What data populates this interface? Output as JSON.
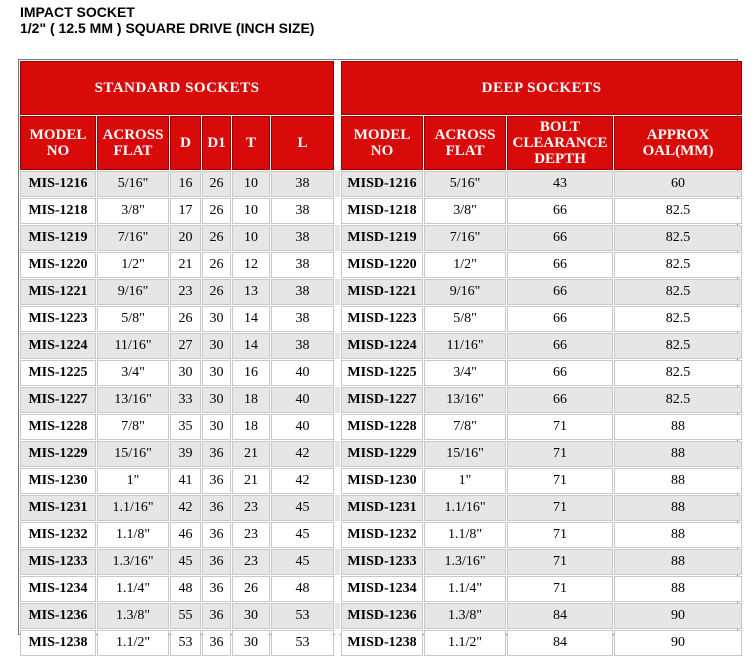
{
  "heading": {
    "line1": "IMPACT SOCKET",
    "line2": "1/2\" ( 12.5 MM ) SQUARE DRIVE (INCH SIZE)"
  },
  "colors": {
    "header_red": "#d90a0a",
    "row_alt_gray": "#e6e6e6"
  },
  "groups": {
    "standard": "STANDARD SOCKETS",
    "deep": "DEEP SOCKETS"
  },
  "columns": {
    "standard": {
      "model": "MODEL NO",
      "across": "ACROSS FLAT",
      "d": "D",
      "d1": "D1",
      "t": "T",
      "l": "L"
    },
    "deep": {
      "model": "MODEL NO",
      "across": "ACROSS FLAT",
      "bolt": "BOLT CLEARANCE DEPTH",
      "oal": "APPROX OAL(MM)"
    }
  },
  "rows": [
    {
      "s_model": "MIS-1216",
      "s_across": "5/16\"",
      "d": "16",
      "d1": "26",
      "t": "10",
      "l": "38",
      "x_model": "MISD-1216",
      "x_across": "5/16\"",
      "bolt": "43",
      "oal": "60"
    },
    {
      "s_model": "MIS-1218",
      "s_across": "3/8\"",
      "d": "17",
      "d1": "26",
      "t": "10",
      "l": "38",
      "x_model": "MISD-1218",
      "x_across": "3/8\"",
      "bolt": "66",
      "oal": "82.5"
    },
    {
      "s_model": "MIS-1219",
      "s_across": "7/16\"",
      "d": "20",
      "d1": "26",
      "t": "10",
      "l": "38",
      "x_model": "MISD-1219",
      "x_across": "7/16\"",
      "bolt": "66",
      "oal": "82.5"
    },
    {
      "s_model": "MIS-1220",
      "s_across": "1/2\"",
      "d": "21",
      "d1": "26",
      "t": "12",
      "l": "38",
      "x_model": "MISD-1220",
      "x_across": "1/2\"",
      "bolt": "66",
      "oal": "82.5"
    },
    {
      "s_model": "MIS-1221",
      "s_across": "9/16\"",
      "d": "23",
      "d1": "26",
      "t": "13",
      "l": "38",
      "x_model": "MISD-1221",
      "x_across": "9/16\"",
      "bolt": "66",
      "oal": "82.5"
    },
    {
      "s_model": "MIS-1223",
      "s_across": "5/8\"",
      "d": "26",
      "d1": "30",
      "t": "14",
      "l": "38",
      "x_model": "MISD-1223",
      "x_across": "5/8\"",
      "bolt": "66",
      "oal": "82.5"
    },
    {
      "s_model": "MIS-1224",
      "s_across": "11/16\"",
      "d": "27",
      "d1": "30",
      "t": "14",
      "l": "38",
      "x_model": "MISD-1224",
      "x_across": "11/16\"",
      "bolt": "66",
      "oal": "82.5"
    },
    {
      "s_model": "MIS-1225",
      "s_across": "3/4\"",
      "d": "30",
      "d1": "30",
      "t": "16",
      "l": "40",
      "x_model": "MISD-1225",
      "x_across": "3/4\"",
      "bolt": "66",
      "oal": "82.5"
    },
    {
      "s_model": "MIS-1227",
      "s_across": "13/16\"",
      "d": "33",
      "d1": "30",
      "t": "18",
      "l": "40",
      "x_model": "MISD-1227",
      "x_across": "13/16\"",
      "bolt": "66",
      "oal": "82.5"
    },
    {
      "s_model": "MIS-1228",
      "s_across": "7/8\"",
      "d": "35",
      "d1": "30",
      "t": "18",
      "l": "40",
      "x_model": "MISD-1228",
      "x_across": "7/8\"",
      "bolt": "71",
      "oal": "88"
    },
    {
      "s_model": "MIS-1229",
      "s_across": "15/16\"",
      "d": "39",
      "d1": "36",
      "t": "21",
      "l": "42",
      "x_model": "MISD-1229",
      "x_across": "15/16\"",
      "bolt": "71",
      "oal": "88"
    },
    {
      "s_model": "MIS-1230",
      "s_across": "1\"",
      "d": "41",
      "d1": "36",
      "t": "21",
      "l": "42",
      "x_model": "MISD-1230",
      "x_across": "1\"",
      "bolt": "71",
      "oal": "88"
    },
    {
      "s_model": "MIS-1231",
      "s_across": "1.1/16\"",
      "d": "42",
      "d1": "36",
      "t": "23",
      "l": "45",
      "x_model": "MISD-1231",
      "x_across": "1.1/16\"",
      "bolt": "71",
      "oal": "88"
    },
    {
      "s_model": "MIS-1232",
      "s_across": "1.1/8\"",
      "d": "46",
      "d1": "36",
      "t": "23",
      "l": "45",
      "x_model": "MISD-1232",
      "x_across": "1.1/8\"",
      "bolt": "71",
      "oal": "88"
    },
    {
      "s_model": "MIS-1233",
      "s_across": "1.3/16\"",
      "d": "45",
      "d1": "36",
      "t": "23",
      "l": "45",
      "x_model": "MISD-1233",
      "x_across": "1.3/16\"",
      "bolt": "71",
      "oal": "88"
    },
    {
      "s_model": "MIS-1234",
      "s_across": "1.1/4\"",
      "d": "48",
      "d1": "36",
      "t": "26",
      "l": "48",
      "x_model": "MISD-1234",
      "x_across": "1.1/4\"",
      "bolt": "71",
      "oal": "88"
    },
    {
      "s_model": "MIS-1236",
      "s_across": "1.3/8\"",
      "d": "55",
      "d1": "36",
      "t": "30",
      "l": "53",
      "x_model": "MISD-1236",
      "x_across": "1.3/8\"",
      "bolt": "84",
      "oal": "90"
    },
    {
      "s_model": "MIS-1238",
      "s_across": "1.1/2\"",
      "d": "53",
      "d1": "36",
      "t": "30",
      "l": "53",
      "x_model": "MISD-1238",
      "x_across": "1.1/2\"",
      "bolt": "84",
      "oal": "90"
    }
  ]
}
